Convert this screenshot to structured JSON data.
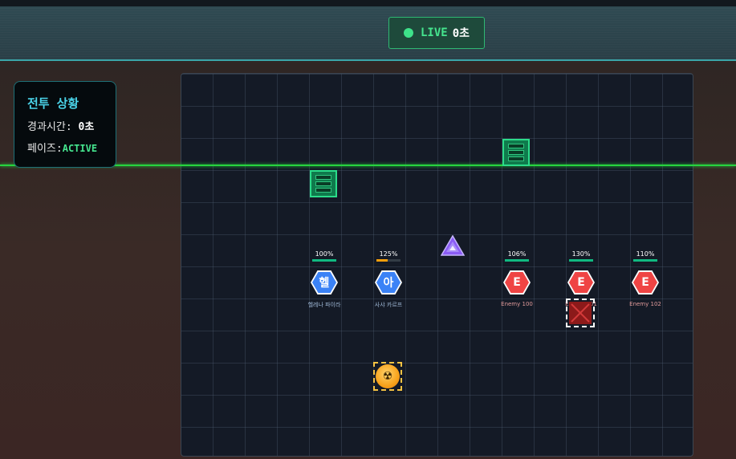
{
  "header": {
    "live_label": "LIVE",
    "elapsed": "0초"
  },
  "status_panel": {
    "title": "전투 상황",
    "elapsed_label": "경과시간:",
    "elapsed_value": "0초",
    "phase_label": "페이즈:",
    "phase_value": "ACTIVE"
  },
  "units": [
    {
      "id": "ally-1",
      "team": "ally",
      "hp_text": "100%",
      "hp": 1.0,
      "hp_color": "#10b981",
      "glyph": "헬",
      "name": "헬레나 파이라"
    },
    {
      "id": "ally-2",
      "team": "ally",
      "hp_text": "125%",
      "hp": 0.45,
      "hp_color": "#f59e0b",
      "glyph": "아",
      "name": "사샤 카르프"
    },
    {
      "id": "enemy-100",
      "team": "enemy",
      "hp_text": "106%",
      "hp": 1.0,
      "hp_color": "#10b981",
      "glyph": "E",
      "name": "Enemy 100"
    },
    {
      "id": "enemy-101",
      "team": "enemy",
      "hp_text": "130%",
      "hp": 1.0,
      "hp_color": "#10b981",
      "glyph": "E",
      "name": "Enemy 101"
    },
    {
      "id": "enemy-102",
      "team": "enemy",
      "hp_text": "110%",
      "hp": 1.0,
      "hp_color": "#10b981",
      "glyph": "E",
      "name": "Enemy 102"
    }
  ],
  "colors": {
    "ally": "#3b82f6",
    "enemy": "#ef4444",
    "live": "#45e58e",
    "accent": "#4ad3e8"
  },
  "icons": {
    "wall": "barrier-icon",
    "powerup": "triangle-crystal-icon",
    "hazard": "radiation-icon",
    "target": "crossed-box-icon"
  }
}
